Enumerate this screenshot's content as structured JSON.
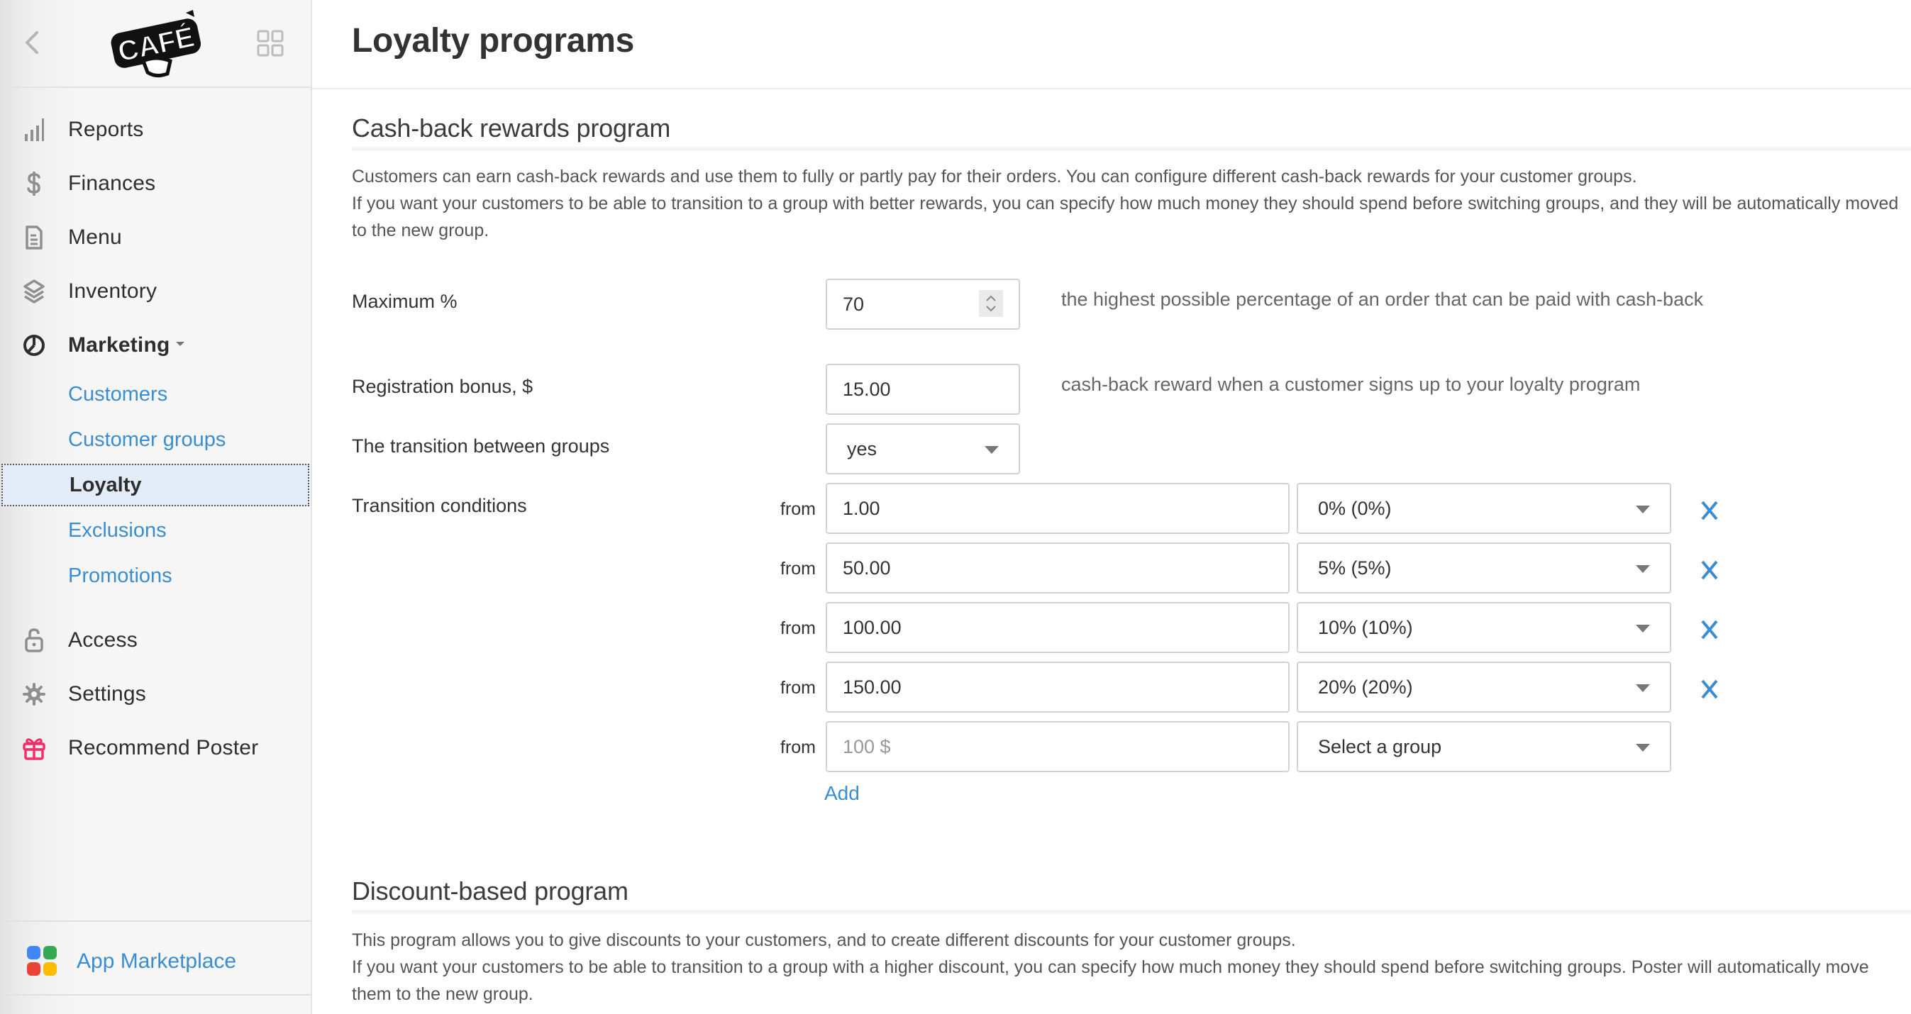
{
  "sidebar": {
    "logo_text": "CAFÉ",
    "back_icon": "chevron-left-icon",
    "apps_icon": "grid-icon",
    "nav": [
      {
        "label": "Reports",
        "icon": "bar-chart-icon"
      },
      {
        "label": "Finances",
        "icon": "dollar-icon"
      },
      {
        "label": "Menu",
        "icon": "document-icon"
      },
      {
        "label": "Inventory",
        "icon": "layers-icon"
      },
      {
        "label": "Marketing",
        "icon": "pie-icon",
        "expanded": true
      }
    ],
    "marketing_sub": [
      {
        "label": "Customers",
        "active": false
      },
      {
        "label": "Customer groups",
        "active": false
      },
      {
        "label": "Loyalty",
        "active": true
      },
      {
        "label": "Exclusions",
        "active": false
      },
      {
        "label": "Promotions",
        "active": false
      }
    ],
    "nav_bottom": [
      {
        "label": "Access",
        "icon": "lock-open-icon"
      },
      {
        "label": "Settings",
        "icon": "gear-icon"
      },
      {
        "label": "Recommend Poster",
        "icon": "gift-icon"
      }
    ],
    "marketplace": {
      "label": "App Marketplace",
      "icon": "apps-tiles-icon"
    }
  },
  "page": {
    "title": "Loyalty programs"
  },
  "cashback": {
    "title": "Cash-back rewards program",
    "desc": [
      "Customers can earn cash-back rewards and use them to fully or partly pay for their orders. You can configure different cash-back rewards for your customer groups.",
      "If you want your customers to be able to transition to a group with better rewards, you can specify how much money they should spend before switching groups, and they will be automatically moved to the new group."
    ],
    "max_percent": {
      "label": "Maximum %",
      "value": "70",
      "hint": "the highest possible percentage of an order that can be paid with cash-back"
    },
    "registration_bonus": {
      "label": "Registration bonus, $",
      "value": "15.00",
      "hint": "cash-back reward when a customer signs up to your loyalty program"
    },
    "transition": {
      "label": "The transition between groups",
      "value": "yes"
    },
    "conditions": {
      "label": "Transition conditions",
      "from_label": "from",
      "rows": [
        {
          "amount": "1.00",
          "group": "0% (0%)"
        },
        {
          "amount": "50.00",
          "group": "5% (5%)"
        },
        {
          "amount": "100.00",
          "group": "10% (10%)"
        },
        {
          "amount": "150.00",
          "group": "20% (20%)"
        }
      ],
      "new_row": {
        "amount_placeholder": "100 $",
        "group_placeholder": "Select a group"
      },
      "add_label": "Add"
    }
  },
  "discount": {
    "title": "Discount-based program",
    "desc": [
      "This program allows you to give discounts to your customers, and to create different discounts for your customer groups.",
      "If you want your customers to be able to transition to a group with a higher discount, you can specify how much money they should spend before switching groups. Poster will automatically move them to the new group."
    ]
  },
  "colors": {
    "link": "#3a8dd0",
    "active_bg": "#e3edf9",
    "gift": "#f0306a",
    "remove": "#3a8dd0"
  }
}
